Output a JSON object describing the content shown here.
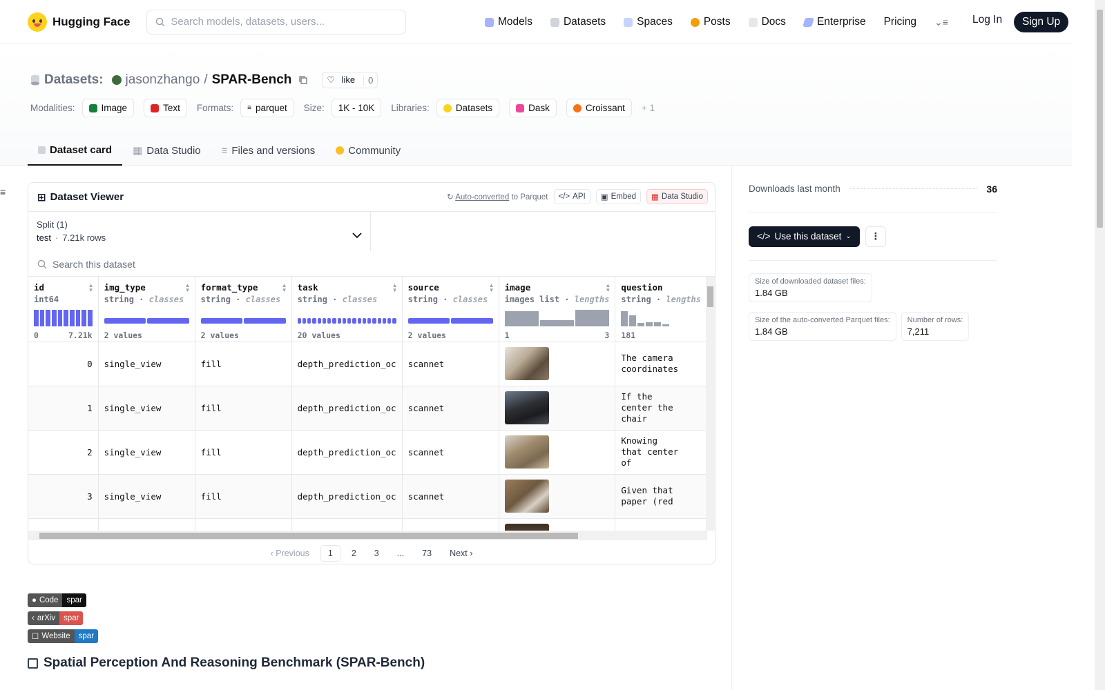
{
  "nav": {
    "brand": "Hugging Face",
    "search_placeholder": "Search models, datasets, users...",
    "links": [
      "Models",
      "Datasets",
      "Spaces",
      "Posts",
      "Docs",
      "Enterprise",
      "Pricing"
    ],
    "login": "Log In",
    "signup": "Sign Up"
  },
  "header": {
    "section": "Datasets:",
    "owner": "jasonzhango",
    "separator": "/",
    "repo": "SPAR-Bench",
    "like_label": "like",
    "like_count": "0",
    "modalities_label": "Modalities:",
    "modalities": [
      "Image",
      "Text"
    ],
    "formats_label": "Formats:",
    "format": "parquet",
    "size_label": "Size:",
    "size": "1K - 10K",
    "libraries_label": "Libraries:",
    "libraries": [
      "Datasets",
      "Dask",
      "Croissant"
    ],
    "more_libraries": "+ 1"
  },
  "tabs": [
    "Dataset card",
    "Data Studio",
    "Files and versions",
    "Community"
  ],
  "viewer": {
    "title": "Dataset Viewer",
    "auto_converted": "Auto-converted",
    "to_parquet": "to Parquet",
    "api": "API",
    "embed": "Embed",
    "data_studio": "Data Studio",
    "split_label": "Split (1)",
    "split_name": "test",
    "split_rows": "7.21k rows",
    "search_placeholder": "Search this dataset",
    "columns": [
      {
        "name": "id",
        "type": "int64",
        "kind": "",
        "foot_left": "0",
        "foot_right": "7.21k"
      },
      {
        "name": "img_type",
        "type": "string",
        "kind": "classes",
        "foot_left": "2 values",
        "foot_right": ""
      },
      {
        "name": "format_type",
        "type": "string",
        "kind": "classes",
        "foot_left": "2 values",
        "foot_right": ""
      },
      {
        "name": "task",
        "type": "string",
        "kind": "classes",
        "foot_left": "20 values",
        "foot_right": ""
      },
      {
        "name": "source",
        "type": "string",
        "kind": "classes",
        "foot_left": "2 values",
        "foot_right": ""
      },
      {
        "name": "image",
        "type": "images list",
        "kind": "lengths",
        "foot_left": "1",
        "foot_right": "3"
      },
      {
        "name": "question",
        "type": "string",
        "kind": "lengths",
        "foot_left": "181",
        "foot_right": ""
      }
    ],
    "rows": [
      {
        "id": "0",
        "img_type": "single_view",
        "format_type": "fill",
        "task": "depth_prediction_oc",
        "source": "scannet",
        "question": "The camera coordinates"
      },
      {
        "id": "1",
        "img_type": "single_view",
        "format_type": "fill",
        "task": "depth_prediction_oc",
        "source": "scannet",
        "question": "If the center the chair"
      },
      {
        "id": "2",
        "img_type": "single_view",
        "format_type": "fill",
        "task": "depth_prediction_oc",
        "source": "scannet",
        "question": "Knowing that center of"
      },
      {
        "id": "3",
        "img_type": "single_view",
        "format_type": "fill",
        "task": "depth_prediction_oc",
        "source": "scannet",
        "question": "Given that paper (red"
      }
    ],
    "pager": {
      "prev": "Previous",
      "pages": [
        "1",
        "2",
        "3",
        "...",
        "73"
      ],
      "next": "Next",
      "current": "1"
    }
  },
  "badges": [
    {
      "left": "Code",
      "right": "spar",
      "color": "#111111"
    },
    {
      "left": "arXiv",
      "right": "spar",
      "color": "#d9534f"
    },
    {
      "left": "Website",
      "right": "spar",
      "color": "#1f79c4"
    }
  ],
  "card_heading": "Spatial Perception And Reasoning Benchmark (SPAR-Bench)",
  "side": {
    "downloads_label": "Downloads last month",
    "downloads_value": "36",
    "use_button": "Use this dataset",
    "size_files_label": "Size of downloaded dataset files:",
    "size_files_value": "1.84 GB",
    "size_parquet_label": "Size of the auto-converted Parquet files:",
    "size_parquet_value": "1.84 GB",
    "rows_label": "Number of rows:",
    "rows_value": "7,211"
  },
  "colors": {
    "accent_bar": "#6366f1",
    "gray_bar": "#9ca3af",
    "dark": "#111827"
  }
}
